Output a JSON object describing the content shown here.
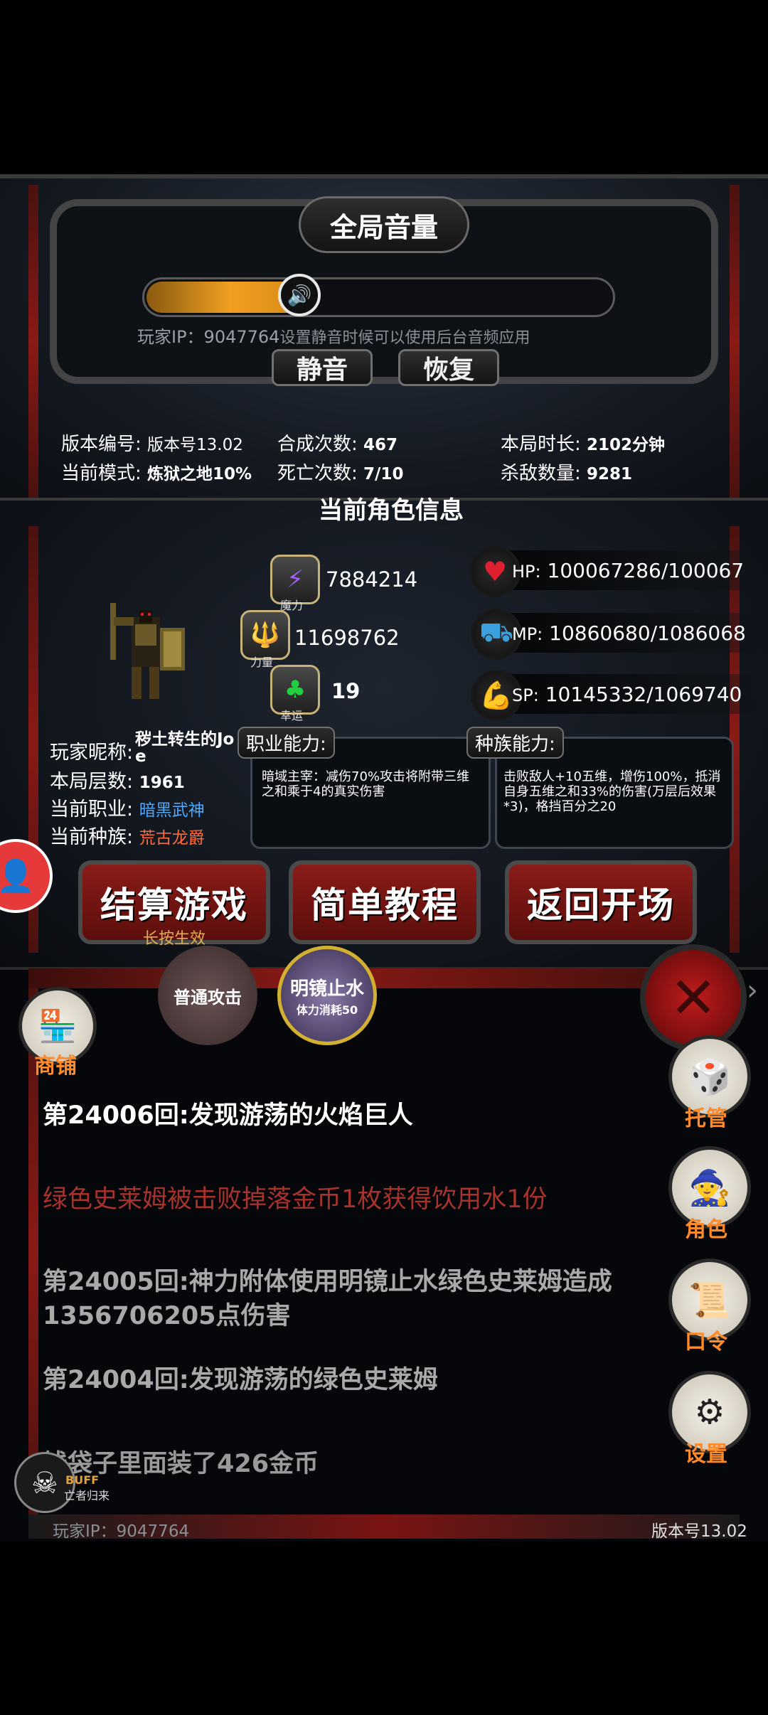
{
  "header": {
    "title": "全局音量",
    "volume_level": 0.33,
    "ip_overlay": "玩家IP：9047764",
    "mute_hint": "设置静音时候可以使用后台音频应用",
    "mute_label": "静音",
    "restore_label": "恢复"
  },
  "stats": {
    "version_label": "版本编号:",
    "version_value": "版本号13.02",
    "mode_label": "当前模式:",
    "mode_value": "炼狱之地10%",
    "craft_label": "合成次数:",
    "craft_value": "467",
    "death_label": "死亡次数:",
    "death_value": "7/10",
    "time_label": "本局时长:",
    "time_value": "2102分钟",
    "kills_label": "杀敌数量:",
    "kills_value": "9281"
  },
  "character": {
    "section_title": "当前角色信息",
    "magic_label": "魔力",
    "magic_value": "7884214",
    "strength_label": "力量",
    "strength_value": "11698762",
    "luck_label": "幸运",
    "luck_value": "19",
    "hp_label": "HP:",
    "hp_value": "100067286/100067",
    "mp_label": "MP:",
    "mp_value": "10860680/1086068",
    "sp_label": "SP:",
    "sp_value": "10145332/1069740",
    "nickname_label": "玩家昵称:",
    "nickname_value": "秽土转生的Jo",
    "nickname_value2": "e",
    "floors_label": "本局层数:",
    "floors_value": "1961",
    "class_label": "当前职业:",
    "class_value": "暗黑武神",
    "race_label": "当前种族:",
    "race_value": "荒古龙爵",
    "class_ability_label": "职业能力:",
    "class_ability_text": "暗域主宰：减伤70%攻击将附带三维之和乘于4的真实伤害",
    "race_ability_label": "种族能力:",
    "race_ability_text": "击败敌人+10五维，增伤100%，抵消自身五维之和33%的伤害(万层后效果*3)，格挡百分之20"
  },
  "actions": {
    "settle_label": "结算游戏",
    "settle_sub": "长按生效",
    "tutorial_label": "简单教程",
    "return_label": "返回开场"
  },
  "bottom": {
    "normal_attack": "普通攻击",
    "skill_name": "明镜止水",
    "skill_cost": "体力消耗50",
    "shop_label": "商铺",
    "auto_label": "托管",
    "role_label": "角色",
    "code_label": "口令",
    "settings_label": "设置",
    "buff_label": "BUFF",
    "buff_name": "亡者归来",
    "footer_ip": "玩家IP：9047764",
    "footer_version": "版本号13.02"
  },
  "log": [
    {
      "text": "第24006回:发现游荡的火焰巨人",
      "color": "#ffffff"
    },
    {
      "text": "绿色史莱姆被击败掉落金币1枚获得饮用水1份",
      "color": "#a8322c"
    },
    {
      "text": "第24005回:神力附体使用明镜止水绿色史莱姆造成",
      "color": "#a9a9a9"
    },
    {
      "text": "1356706205点伤害",
      "color": "#a9a9a9"
    },
    {
      "text": "第24004回:发现游荡的绿色史莱姆",
      "color": "#a9a9a9"
    },
    {
      "text": "钱袋子里面装了426金币",
      "color": "#9a9a9a"
    }
  ]
}
